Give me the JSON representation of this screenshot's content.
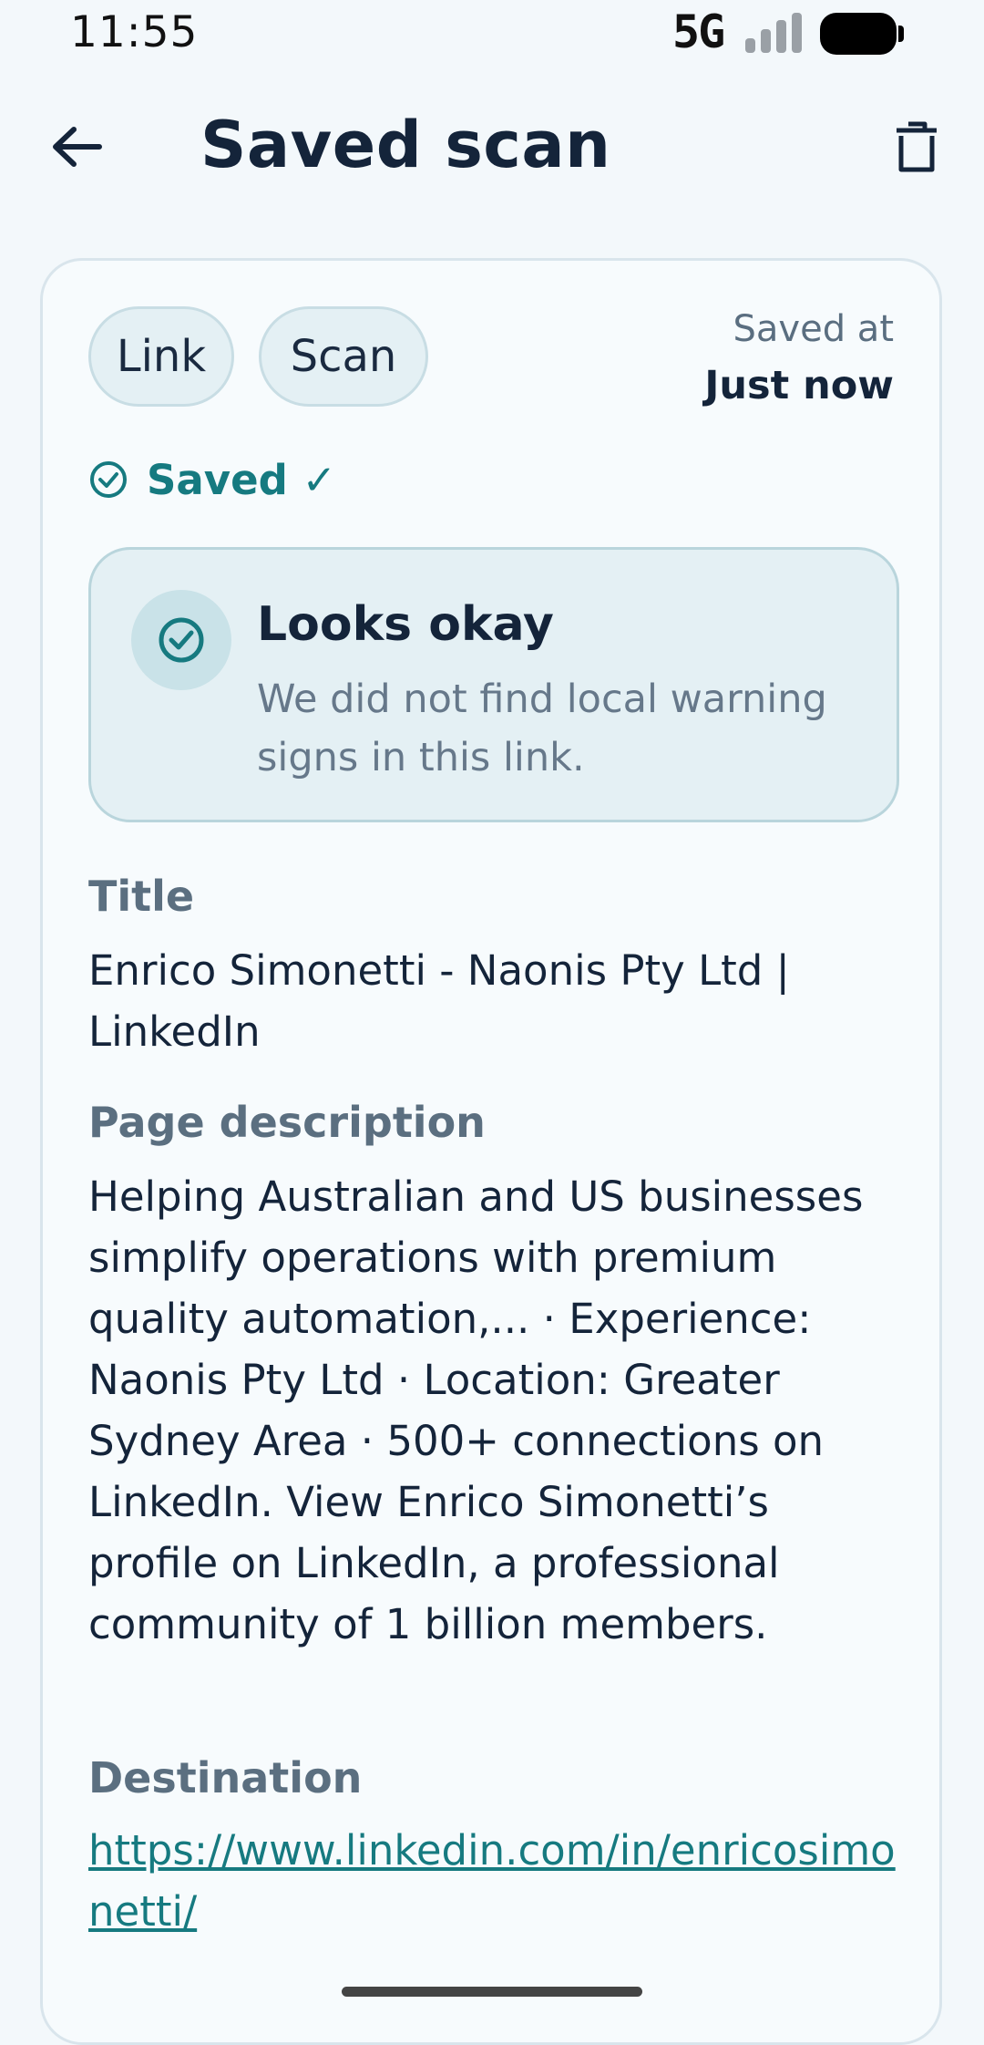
{
  "status_bar": {
    "time": "11:55",
    "network": "5G"
  },
  "app_bar": {
    "title": "Saved scan",
    "back_icon": "arrow-left-icon",
    "delete_icon": "trash-icon"
  },
  "card": {
    "chips": [
      "Link",
      "Scan"
    ],
    "saved_at_label": "Saved at",
    "saved_at_value": "Just now",
    "saved_status": "Saved ✓",
    "verdict": {
      "title": "Looks okay",
      "body": "We did not find local warning signs in this link."
    },
    "title_label": "Title",
    "title_value": "Enrico Simonetti - Naonis Pty Ltd | LinkedIn",
    "description_label": "Page description",
    "description_value": "Helping Australian and US businesses simplify operations with premium quality automation,... · Experience: Naonis Pty Ltd · Location: Greater Sydney Area · 500+ connections on LinkedIn. View Enrico Simonetti’s profile on LinkedIn, a professional community of 1 billion members.",
    "destination_label": "Destination",
    "destination_value": "https://www.linkedin.com/in/enricosimonetti/"
  },
  "colors": {
    "accent": "#167a80",
    "text": "#14243a",
    "muted": "#5b6f80",
    "background": "#f3f8fb"
  }
}
